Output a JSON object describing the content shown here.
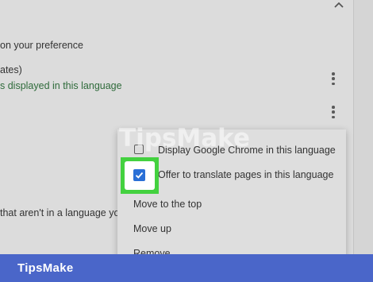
{
  "settings": {
    "preference_text": "on your preference",
    "lang_row_title": "ates)",
    "lang_row_subtitle": "s displayed in this language",
    "bottom_text": "that aren't in a language you r"
  },
  "context_menu": {
    "items": [
      {
        "label": "Display Google Chrome in this language",
        "checked": false
      },
      {
        "label": "Offer to translate pages in this language",
        "checked": true
      },
      {
        "label": "Move to the top"
      },
      {
        "label": "Move up"
      },
      {
        "label": "Remove"
      }
    ]
  },
  "watermark": "TipsMake",
  "footer": {
    "brand": "TipsMake"
  },
  "colors": {
    "highlight": "#43d13f",
    "checkbox_checked": "#2a6fd6",
    "link_green": "#2f6b3b",
    "brand_bar": "#4a66c9"
  },
  "icons": [
    "chevron-up-icon",
    "more-vert-icon",
    "checkbox-icon",
    "checkmark-icon"
  ]
}
